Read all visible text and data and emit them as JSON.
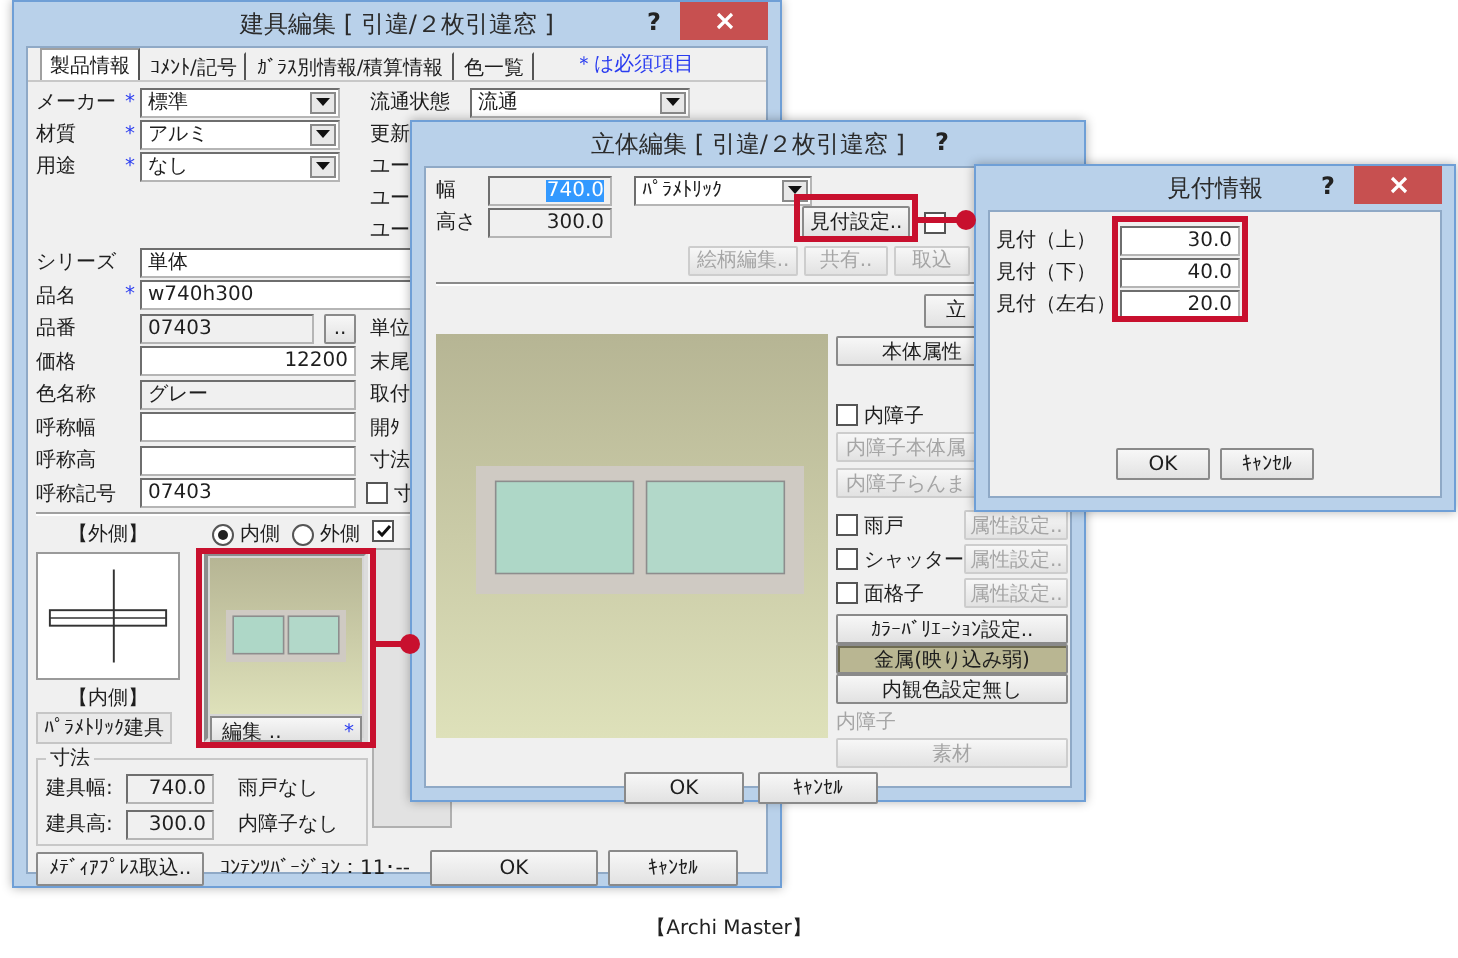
{
  "main_window": {
    "title": "建具編集 [ 引違/２枚引違窓 ]",
    "help": "?",
    "tabs": [
      {
        "label": "製品情報",
        "selected": true
      },
      {
        "label": "ｺﾒﾝﾄ/記号",
        "selected": false
      },
      {
        "label": "ｶﾞﾗｽ別情報/積算情報",
        "selected": false
      },
      {
        "label": "色一覧",
        "selected": false
      }
    ],
    "required_note": "＊は必須項目",
    "upper_rows": [
      {
        "label": "メーカー",
        "marker": "*",
        "field": {
          "kind": "dropdown",
          "value": "標準"
        },
        "side": {
          "kind": "dropdown",
          "label": "流通状態",
          "value": "流通"
        }
      },
      {
        "label": "材質",
        "marker": "*",
        "field": {
          "kind": "dropdown",
          "value": "アルミ"
        },
        "side": {
          "kind": "label",
          "label": "更新"
        }
      },
      {
        "label": "用途",
        "marker": "*",
        "field": {
          "kind": "dropdown",
          "value": "なし"
        },
        "side": {
          "kind": "label",
          "label": "ユー"
        }
      },
      {
        "side": {
          "kind": "label",
          "label": "ユー"
        }
      },
      {
        "side": {
          "kind": "label",
          "label": "ユー"
        }
      }
    ],
    "detail_rows": [
      {
        "label": "シリーズ",
        "field": {
          "kind": "text",
          "value": "単体"
        }
      },
      {
        "label": "品名",
        "marker": "*",
        "field": {
          "kind": "text",
          "value": "w740h300"
        }
      },
      {
        "label": "品番",
        "field": {
          "kind": "readonly",
          "value": "07403",
          "browse": ".."
        },
        "side": {
          "kind": "label",
          "label": "単位"
        }
      },
      {
        "label": "価格",
        "field": {
          "kind": "number",
          "value": "12200"
        },
        "side": {
          "kind": "label",
          "label": "末尾"
        }
      },
      {
        "label": "色名称",
        "field": {
          "kind": "readonly",
          "value": "グレー"
        },
        "side": {
          "kind": "label",
          "label": "取付"
        }
      },
      {
        "label": "呼称幅",
        "field": {
          "kind": "text"
        },
        "side": {
          "kind": "label",
          "label": "開ﾀ"
        }
      },
      {
        "label": "呼称高",
        "field": {
          "kind": "text"
        },
        "side": {
          "kind": "label",
          "label": "寸法"
        }
      },
      {
        "label": "呼称記号",
        "field": {
          "kind": "text",
          "value": "07403"
        },
        "side": {
          "kind": "checkbox",
          "label": "寸",
          "checked": false
        }
      }
    ],
    "view": {
      "outside_label": "【外側】",
      "inside_label": "【内側】",
      "side_options": [
        {
          "label": "内側",
          "selected": true
        },
        {
          "label": "外側",
          "selected": false
        }
      ],
      "preview_check": {
        "checked": true
      },
      "edit_button": "編集 ..",
      "edit_marker": "*",
      "type_label": "ﾊﾟﾗﾒﾄﾘｯｸ建具"
    },
    "size_group": {
      "title": "寸法",
      "rows": [
        {
          "label": "建具幅:",
          "value": "740.0",
          "note": "雨戸なし"
        },
        {
          "label": "建具高:",
          "value": "300.0",
          "note": "内障子なし"
        }
      ]
    },
    "import_button": "ﾒﾃﾞｨｱﾌﾟﾚｽ取込..",
    "version": "ｺﾝﾃﾝﾂﾊﾞｰｼﾞｮﾝ：11･--",
    "buttons": [
      "OK",
      "ｷｬﾝｾﾙ"
    ]
  },
  "solid_window": {
    "title": "立体編集 [ 引違/２枚引違窓 ]",
    "help": "?",
    "width": {
      "label": "幅",
      "value": "740.0",
      "text_selected": true
    },
    "height": {
      "label": "高さ",
      "value": "300.0"
    },
    "type_dropdown": "ﾊﾟﾗﾒﾄﾘｯｸ",
    "frame_button": {
      "label": "見付設定..",
      "disabled": false
    },
    "extra_check": {
      "checked": false
    },
    "tool_buttons": [
      {
        "label": "絵柄編集..",
        "disabled": true
      },
      {
        "label": "共有..",
        "disabled": true
      },
      {
        "label": "取込",
        "disabled": true
      }
    ],
    "view_button": "立",
    "options": [
      {
        "kind": "button",
        "label": "本体属性",
        "disabled": false,
        "pressed": false
      },
      {
        "kind": "checkbox",
        "label": "内障子",
        "checked": false
      },
      {
        "kind": "button",
        "label": "内障子本体属",
        "disabled": true,
        "pressed": false
      },
      {
        "kind": "button",
        "label": "内障子らんま",
        "disabled": true,
        "pressed": false
      },
      {
        "kind": "check_button",
        "label": "雨戸",
        "checked": false,
        "button": "属性設定..",
        "disabled": true
      },
      {
        "kind": "check_button",
        "label": "シャッター",
        "checked": false,
        "button": "属性設定..",
        "disabled": true
      },
      {
        "kind": "check_button",
        "label": "面格子",
        "checked": false,
        "button": "属性設定..",
        "disabled": true
      },
      {
        "kind": "button",
        "label": "ｶﾗｰﾊﾞﾘｴｰｼｮﾝ設定..",
        "disabled": false,
        "pressed": false
      },
      {
        "kind": "button",
        "label": "金属(映り込み弱)",
        "disabled": false,
        "pressed": true
      },
      {
        "kind": "button",
        "label": "内観色設定無し",
        "disabled": false,
        "pressed": false
      },
      {
        "kind": "label",
        "label": "内障子",
        "disabled": true
      },
      {
        "kind": "button",
        "label": "素材",
        "disabled": true,
        "pressed": false
      }
    ],
    "buttons": [
      "OK",
      "ｷｬﾝｾﾙ"
    ]
  },
  "frame_window": {
    "title": "見付情報",
    "help": "?",
    "rows": [
      {
        "label": "見付（上）",
        "value": "30.0"
      },
      {
        "label": "見付（下）",
        "value": "40.0"
      },
      {
        "label": "見付（左右）",
        "value": "20.0"
      }
    ],
    "buttons": [
      "OK",
      "ｷｬﾝｾﾙ"
    ]
  },
  "caption": "【Archi Master】"
}
